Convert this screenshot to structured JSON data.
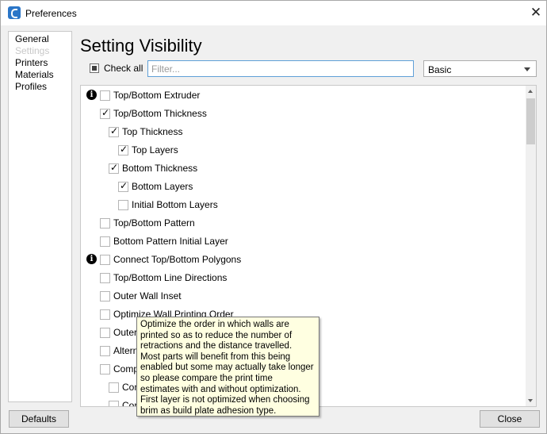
{
  "window": {
    "title": "Preferences",
    "app_icon": "cura-logo-icon",
    "close_icon": "close-icon"
  },
  "nav": {
    "items": [
      {
        "label": "General",
        "active": false
      },
      {
        "label": "Settings",
        "active": true
      },
      {
        "label": "Printers",
        "active": false
      },
      {
        "label": "Materials",
        "active": false
      },
      {
        "label": "Profiles",
        "active": false
      }
    ]
  },
  "page": {
    "heading": "Setting Visibility",
    "check_all_label": "Check all",
    "filter_placeholder": "Filter...",
    "visibility_preset": "Basic"
  },
  "settings": [
    {
      "label": "Top/Bottom Extruder",
      "checked": false,
      "info": true,
      "indent": 0
    },
    {
      "label": "Top/Bottom Thickness",
      "checked": true,
      "info": false,
      "indent": 0
    },
    {
      "label": "Top Thickness",
      "checked": true,
      "info": false,
      "indent": 1
    },
    {
      "label": "Top Layers",
      "checked": true,
      "info": false,
      "indent": 2
    },
    {
      "label": "Bottom Thickness",
      "checked": true,
      "info": false,
      "indent": 1
    },
    {
      "label": "Bottom Layers",
      "checked": true,
      "info": false,
      "indent": 2
    },
    {
      "label": "Initial Bottom Layers",
      "checked": false,
      "info": false,
      "indent": 2
    },
    {
      "label": "Top/Bottom Pattern",
      "checked": false,
      "info": false,
      "indent": 0
    },
    {
      "label": "Bottom Pattern Initial Layer",
      "checked": false,
      "info": false,
      "indent": 0
    },
    {
      "label": "Connect Top/Bottom Polygons",
      "checked": false,
      "info": true,
      "indent": 0
    },
    {
      "label": "Top/Bottom Line Directions",
      "checked": false,
      "info": false,
      "indent": 0
    },
    {
      "label": "Outer Wall Inset",
      "checked": false,
      "info": false,
      "indent": 0
    },
    {
      "label": "Optimize Wall Printing Order",
      "checked": false,
      "info": false,
      "indent": 0
    },
    {
      "label": "Outer",
      "checked": false,
      "info": false,
      "indent": 0
    },
    {
      "label": "Altern",
      "checked": false,
      "info": false,
      "indent": 0
    },
    {
      "label": "Comp",
      "checked": false,
      "info": false,
      "indent": 0
    },
    {
      "label": "Con",
      "checked": false,
      "info": false,
      "indent": 1
    },
    {
      "label": "Con",
      "checked": false,
      "info": false,
      "indent": 1
    }
  ],
  "tooltip": {
    "lines": [
      "Optimize the order in which walls are",
      "printed so as to reduce the number of",
      "retractions and the distance travelled.",
      "Most parts will benefit from this being",
      "enabled but some may actually take longer",
      "so please compare the print time",
      "estimates with and without optimization.",
      "First layer is not optimized when choosing",
      "brim as build plate adhesion type."
    ]
  },
  "buttons": {
    "defaults": "Defaults",
    "close": "Close"
  }
}
